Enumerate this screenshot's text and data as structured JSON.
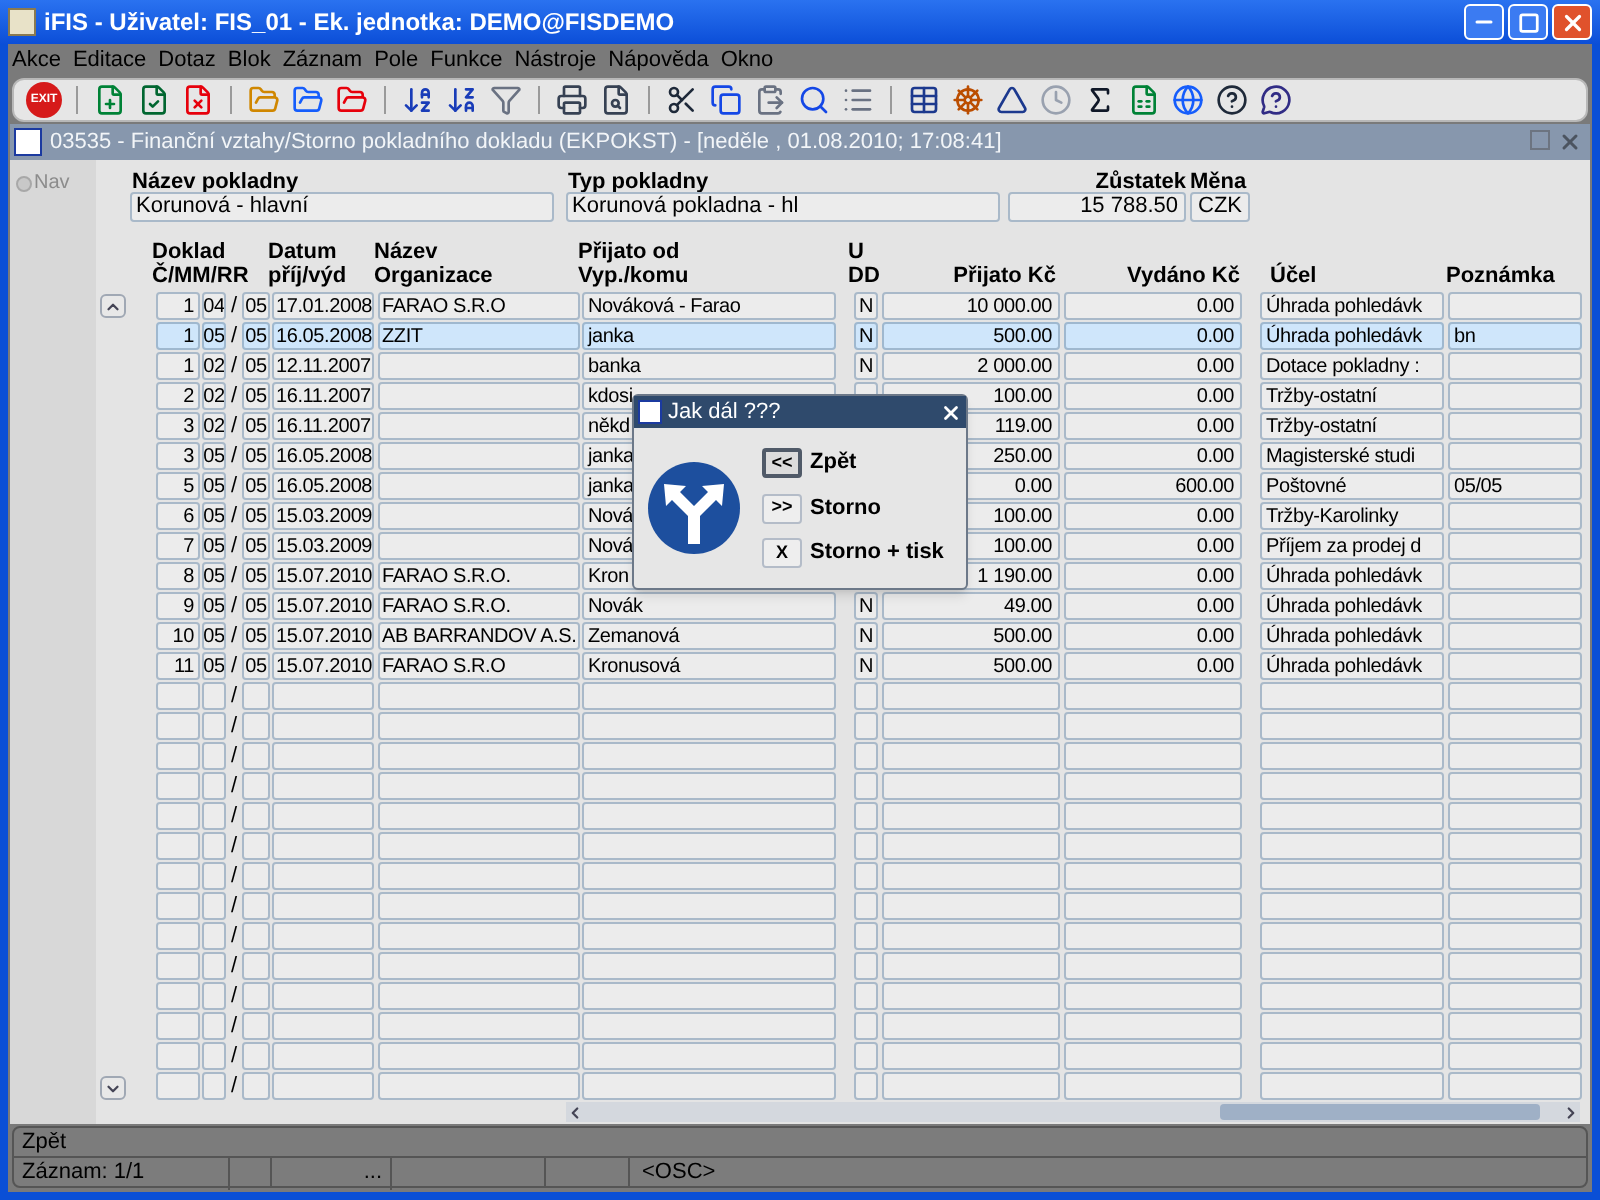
{
  "window": {
    "title": "iFIS - Uživatel: FIS_01 - Ek. jednotka: DEMO@FISDEMO"
  },
  "menu": [
    "Akce",
    "Editace",
    "Dotaz",
    "Blok",
    "Záznam",
    "Pole",
    "Funkce",
    "Nástroje",
    "Nápověda",
    "Okno"
  ],
  "toolbar": {
    "exit_label": "EXIT"
  },
  "form_window": {
    "title": "03535 - Finanční vztahy/Storno pokladního dokladu (EKPOKST) - [neděle , 01.08.2010; 17:08:41]"
  },
  "nav": {
    "label": "Nav",
    "selected": false
  },
  "header_fields": [
    {
      "label": "Název pokladny",
      "value": "Korunová - hlavní"
    },
    {
      "label": "Typ pokladny",
      "value": "Korunová pokladna - hl"
    }
  ],
  "balance": {
    "label": "Zůstatek",
    "value": "15 788.50"
  },
  "currency": {
    "label": "Měna",
    "value": "CZK"
  },
  "columns": [
    "Doklad\nČ/MM/RR",
    "Datum\npříj/výd",
    "Název\nOrganizace",
    "Přijato od\nVyp./komu",
    "U\nDD",
    "Přijato Kč",
    "Vydáno Kč",
    "Účel",
    "Poznámka"
  ],
  "rows": [
    {
      "selected": false,
      "number": "1",
      "mm": "04",
      "slash": "/",
      "rr": "05",
      "date": "17.01.2008",
      "organization": "FARAO S.R.O",
      "party": "Nováková - Farao",
      "u_dd": "N",
      "received": "10 000.00",
      "paid": "0.00",
      "purpose": "Úhrada pohledávk"
    },
    {
      "selected": true,
      "number": "1",
      "mm": "05",
      "slash": "/",
      "rr": "05",
      "date": "16.05.2008",
      "organization": "ZZIT",
      "party": "janka",
      "u_dd": "N",
      "received": "500.00",
      "paid": "0.00",
      "purpose": "Úhrada pohledávk",
      "note": "bn"
    },
    {
      "selected": false,
      "number": "1",
      "mm": "02",
      "slash": "/",
      "rr": "05",
      "date": "12.11.2007",
      "party": "banka",
      "u_dd": "N",
      "received": "2 000.00",
      "paid": "0.00",
      "purpose": "Dotace pokladny :"
    },
    {
      "selected": false,
      "number": "2",
      "mm": "02",
      "slash": "/",
      "rr": "05",
      "date": "16.11.2007",
      "party": "kdosi",
      "received": "100.00",
      "paid": "0.00",
      "purpose": "Tržby-ostatní"
    },
    {
      "selected": false,
      "number": "3",
      "mm": "02",
      "slash": "/",
      "rr": "05",
      "date": "16.11.2007",
      "party": "někd",
      "received": "119.00",
      "paid": "0.00",
      "purpose": "Tržby-ostatní"
    },
    {
      "selected": false,
      "number": "3",
      "mm": "05",
      "slash": "/",
      "rr": "05",
      "date": "16.05.2008",
      "party": "janka",
      "received": "250.00",
      "paid": "0.00",
      "purpose": "Magisterské studi"
    },
    {
      "selected": false,
      "number": "5",
      "mm": "05",
      "slash": "/",
      "rr": "05",
      "date": "16.05.2008",
      "party": "janka",
      "received": "0.00",
      "paid": "600.00",
      "purpose": "Poštovné",
      "note": "05/05"
    },
    {
      "selected": false,
      "number": "6",
      "mm": "05",
      "slash": "/",
      "rr": "05",
      "date": "15.03.2009",
      "party": "Nová",
      "received": "100.00",
      "paid": "0.00",
      "purpose": "Tržby-Karolinky"
    },
    {
      "selected": false,
      "number": "7",
      "mm": "05",
      "slash": "/",
      "rr": "05",
      "date": "15.03.2009",
      "party": "Nová",
      "received": "100.00",
      "paid": "0.00",
      "purpose": "Příjem za prodej d"
    },
    {
      "selected": false,
      "number": "8",
      "mm": "05",
      "slash": "/",
      "rr": "05",
      "date": "15.07.2010",
      "organization": "FARAO S.R.O.",
      "party": "Kron",
      "received": "1 190.00",
      "paid": "0.00",
      "purpose": "Úhrada pohledávk"
    },
    {
      "selected": false,
      "number": "9",
      "mm": "05",
      "slash": "/",
      "rr": "05",
      "date": "15.07.2010",
      "organization": "FARAO S.R.O.",
      "party": "Novák",
      "u_dd": "N",
      "received": "49.00",
      "paid": "0.00",
      "purpose": "Úhrada pohledávk"
    },
    {
      "selected": false,
      "number": "10",
      "mm": "05",
      "slash": "/",
      "rr": "05",
      "date": "15.07.2010",
      "organization": "AB BARRANDOV A.S.",
      "party": "Zemanová",
      "u_dd": "N",
      "received": "500.00",
      "paid": "0.00",
      "purpose": "Úhrada pohledávk"
    },
    {
      "selected": false,
      "number": "11",
      "mm": "05",
      "slash": "/",
      "rr": "05",
      "date": "15.07.2010",
      "organization": "FARAO S.R.O",
      "party": "Kronusová",
      "u_dd": "N",
      "received": "500.00",
      "paid": "0.00",
      "purpose": "Úhrada pohledávk"
    },
    {
      "selected": false,
      "slash": "/"
    },
    {
      "selected": false,
      "slash": "/"
    },
    {
      "selected": false,
      "slash": "/"
    },
    {
      "selected": false,
      "slash": "/"
    },
    {
      "selected": false,
      "slash": "/"
    },
    {
      "selected": false,
      "slash": "/"
    },
    {
      "selected": false,
      "slash": "/"
    },
    {
      "selected": false,
      "slash": "/"
    },
    {
      "selected": false,
      "slash": "/"
    },
    {
      "selected": false,
      "slash": "/"
    },
    {
      "selected": false,
      "slash": "/"
    },
    {
      "selected": false,
      "slash": "/"
    },
    {
      "selected": false,
      "slash": "/"
    },
    {
      "selected": false,
      "slash": "/"
    }
  ],
  "dialog": {
    "title": "Jak dál ???",
    "buttons": [
      {
        "key": "<<",
        "label": "Zpět",
        "focused": true
      },
      {
        "key": ">>",
        "label": "Storno",
        "focused": false
      },
      {
        "key": "X",
        "label": "Storno + tisk",
        "focused": false
      }
    ]
  },
  "status_bar": {
    "message": "Zpět",
    "record": "Záznam: 1/1",
    "field_3": "...",
    "mode": "<OSC>"
  }
}
